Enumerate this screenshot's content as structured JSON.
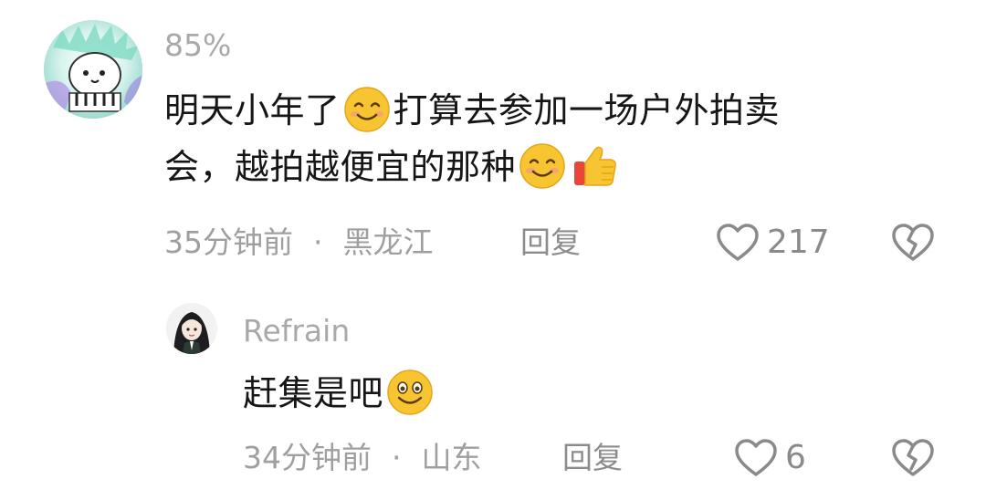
{
  "comment": {
    "username": "85%",
    "text_line1_a": "明天小年了",
    "text_line1_b": "打算去参加一场户外拍卖",
    "text_line2": "会，越拍越便宜的那种",
    "time": "35分钟前",
    "location": "黑龙江",
    "separator": "·",
    "reply_label": "回复",
    "like_count": "217",
    "emojis": [
      "smile-emoji",
      "smile-emoji",
      "thumbs-up-emoji"
    ]
  },
  "reply": {
    "username": "Refrain",
    "text": "赶集是吧",
    "time": "34分钟前",
    "location": "山东",
    "separator": "·",
    "reply_label": "回复",
    "like_count": "6",
    "emojis": [
      "grin-emoji"
    ]
  },
  "colors": {
    "username": "#a9a9a9",
    "meta": "#9f9f9f",
    "text": "#161616",
    "icon": "#8a8a8a"
  }
}
